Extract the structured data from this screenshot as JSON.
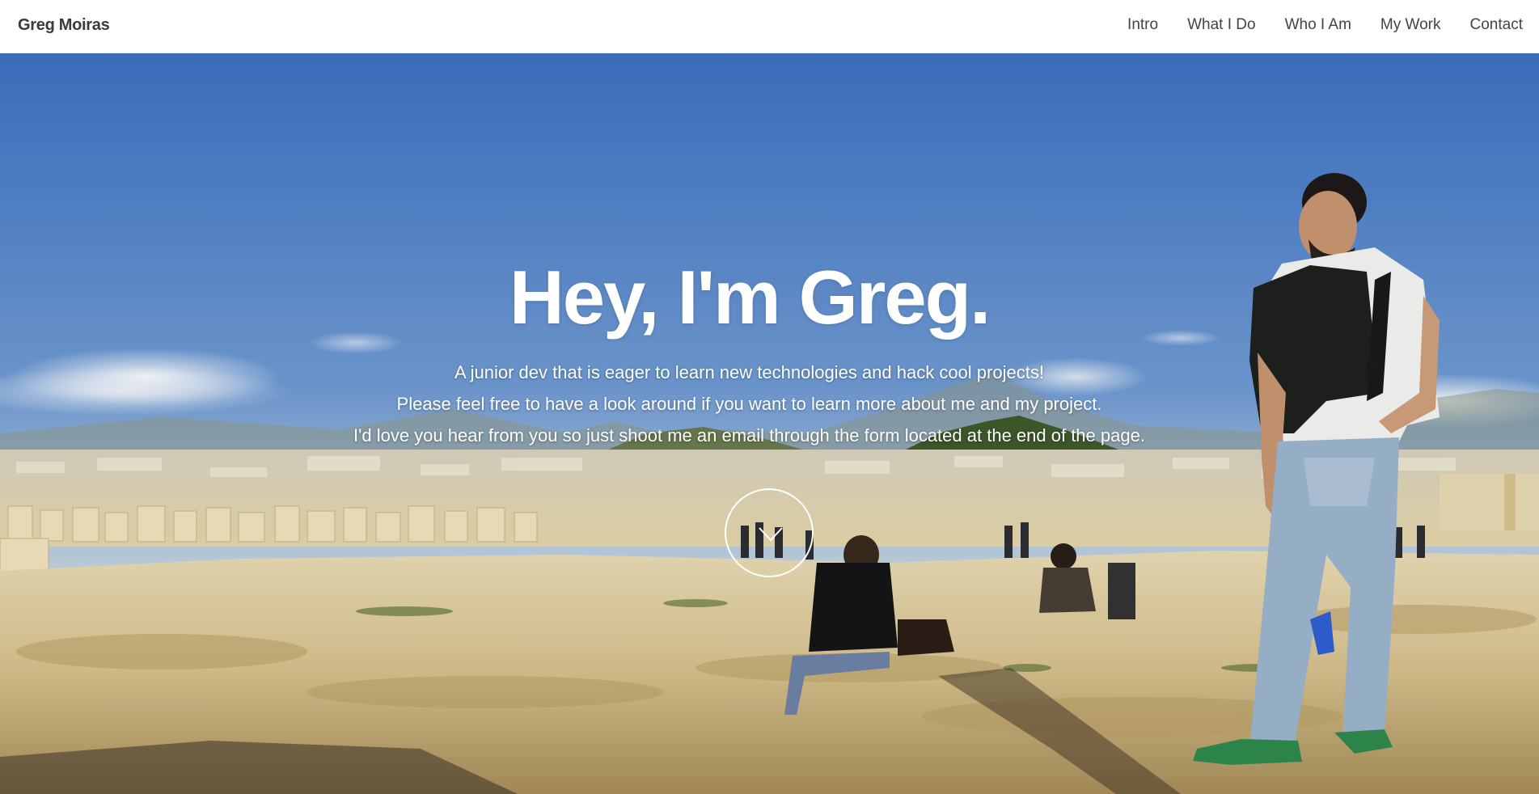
{
  "brand": "Greg Moiras",
  "nav": [
    {
      "label": "Intro"
    },
    {
      "label": "What I Do"
    },
    {
      "label": "Who I Am"
    },
    {
      "label": "My Work"
    },
    {
      "label": "Contact"
    }
  ],
  "hero": {
    "title": "Hey, I'm Greg.",
    "lines": [
      "A junior dev that is eager to learn new technologies and hack cool projects!",
      "Please feel free to have a look around if you want to learn more about me and my project.",
      "I'd love you hear from you so just shoot me an email through the form located at the end of the page."
    ],
    "scroll_icon": "chevron-down-icon"
  },
  "colors": {
    "sky_top": "#3f74c4",
    "sky_bottom": "#9ec1e3",
    "ground": "#d9c9a0",
    "text_on_photo": "#ffffff",
    "nav_text": "#444444"
  }
}
